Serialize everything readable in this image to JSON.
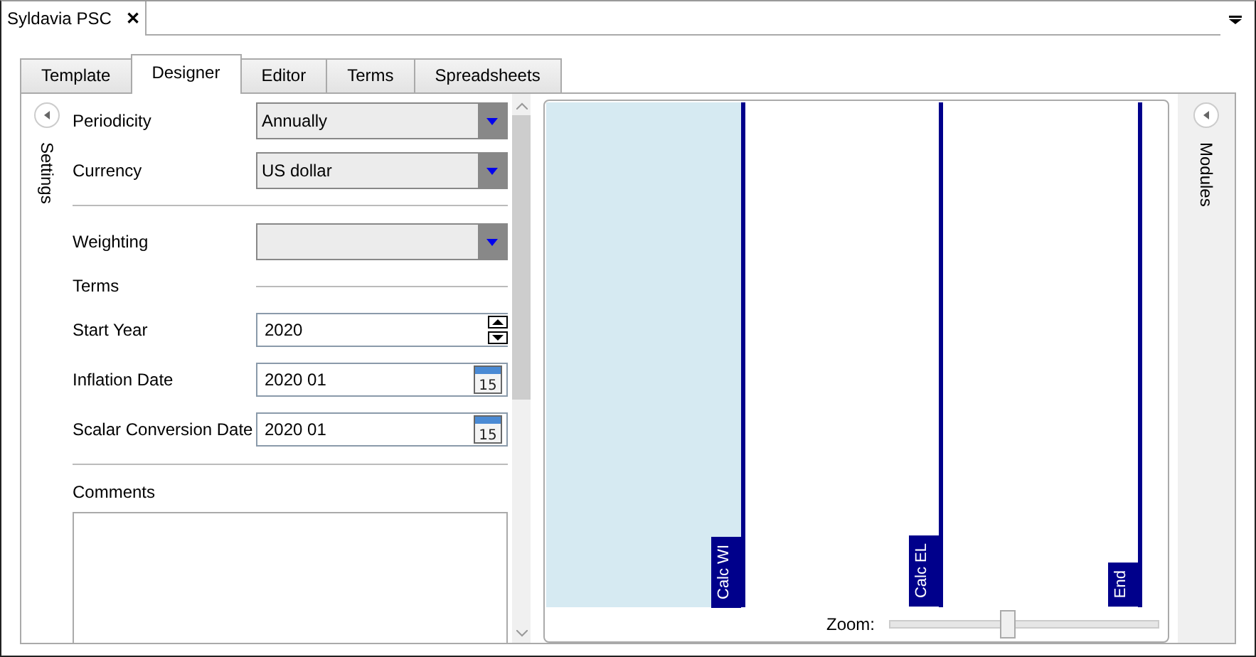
{
  "document_tab": {
    "title": "Syldavia PSC",
    "close": "✕"
  },
  "tabs": [
    {
      "label": "Template",
      "selected": false
    },
    {
      "label": "Designer",
      "selected": true
    },
    {
      "label": "Editor",
      "selected": false
    },
    {
      "label": "Terms",
      "selected": false
    },
    {
      "label": "Spreadsheets",
      "selected": false
    }
  ],
  "settings_panel": {
    "title": "Settings",
    "fields": [
      {
        "kind": "select",
        "label": "Periodicity",
        "value": "Annually"
      },
      {
        "kind": "select",
        "label": "Currency",
        "value": "US dollar"
      },
      {
        "kind": "divider"
      },
      {
        "kind": "select",
        "label": "Weighting"
      },
      {
        "kind": "section",
        "label": "Terms"
      },
      {
        "kind": "spinner",
        "label": "Start Year",
        "value": "2020"
      },
      {
        "kind": "date",
        "label": "Inflation Date",
        "value": "2020 01",
        "calendar_day": "15"
      },
      {
        "kind": "date",
        "label": "Scalar Conversion Date",
        "value": "2020 01",
        "calendar_day": "15"
      },
      {
        "kind": "divider"
      },
      {
        "kind": "textarea",
        "label": "Comments"
      }
    ]
  },
  "timeline": {
    "segments": [
      {
        "marker": "Calc WI",
        "highlighted": true
      },
      {
        "marker": "Calc EL",
        "highlighted": false
      },
      {
        "marker": "End",
        "highlighted": false
      }
    ],
    "zoom": {
      "label": "Zoom:",
      "level": 0.44
    }
  },
  "modules_panel": {
    "title": "Modules"
  }
}
